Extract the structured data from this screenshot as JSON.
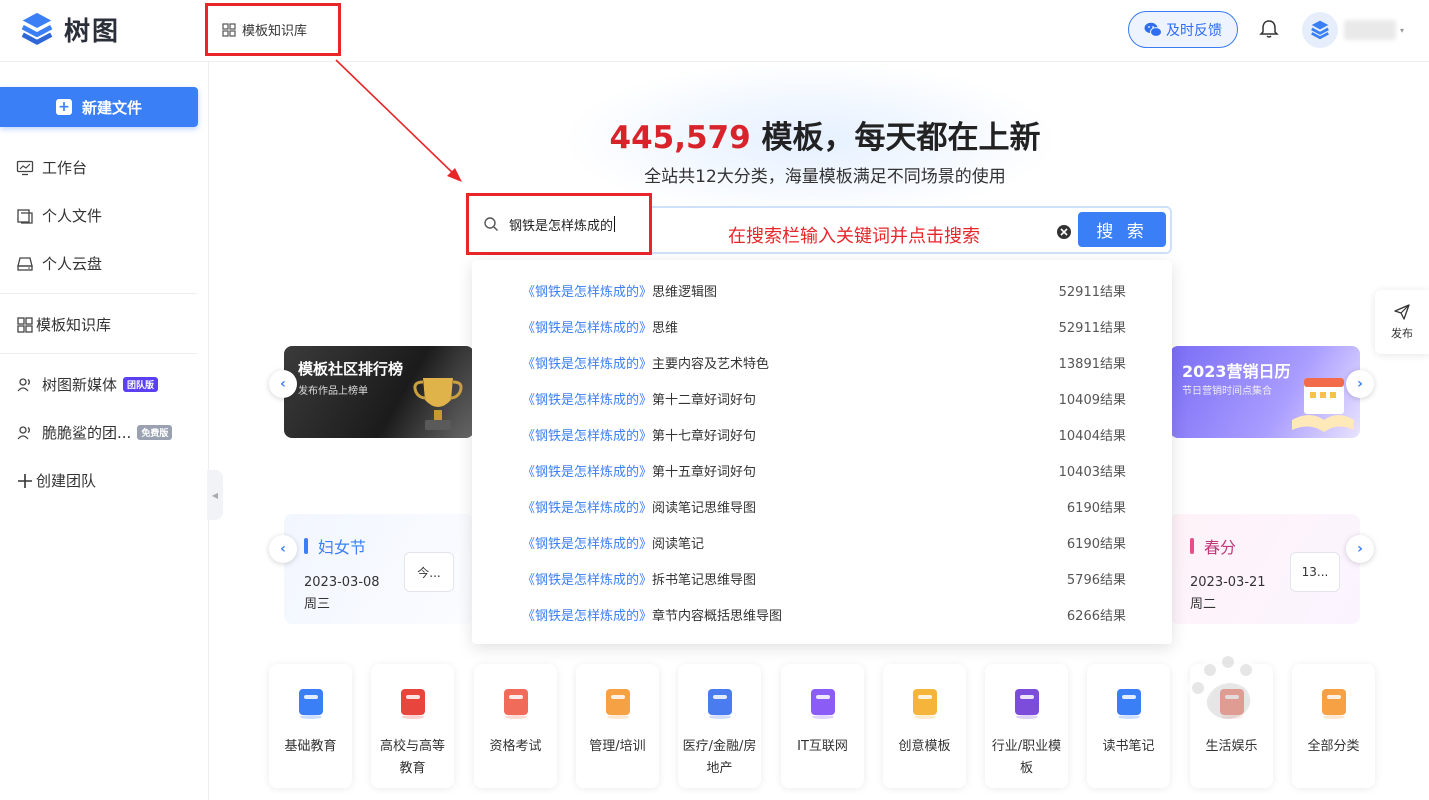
{
  "header": {
    "logo_text": "树图",
    "nav_template_label": "模板知识库",
    "feedback_label": "及时反馈"
  },
  "sidebar": {
    "new_file_label": "新建文件",
    "items": [
      {
        "label": "工作台"
      },
      {
        "label": "个人文件"
      },
      {
        "label": "个人云盘"
      },
      {
        "label": "模板知识库"
      },
      {
        "label": "树图新媒体",
        "badge": "团队版"
      },
      {
        "label": "脆脆鲨的团...",
        "badge": "免费版"
      },
      {
        "label": "创建团队"
      }
    ]
  },
  "hero": {
    "count": "445,579",
    "title_rest": " 模板，每天都在上新",
    "subtitle": "全站共12大分类，海量模板满足不同场景的使用"
  },
  "search": {
    "value": "钢铁是怎样炼成的",
    "button_label": "搜 索",
    "annotation": "在搜索栏输入关键词并点击搜索"
  },
  "suggestions": [
    {
      "keyword": "《钢铁是怎样炼成的》",
      "suffix": "思维逻辑图",
      "count": "52911结果"
    },
    {
      "keyword": "《钢铁是怎样炼成的》",
      "suffix": "思维",
      "count": "52911结果"
    },
    {
      "keyword": "《钢铁是怎样炼成的》",
      "suffix": "主要内容及艺术特色",
      "count": "13891结果"
    },
    {
      "keyword": "《钢铁是怎样炼成的》",
      "suffix": "第十二章好词好句",
      "count": "10409结果"
    },
    {
      "keyword": "《钢铁是怎样炼成的》",
      "suffix": "第十七章好词好句",
      "count": "10404结果"
    },
    {
      "keyword": "《钢铁是怎样炼成的》",
      "suffix": "第十五章好词好句",
      "count": "10403结果"
    },
    {
      "keyword": "《钢铁是怎样炼成的》",
      "suffix": "阅读笔记思维导图",
      "count": "6190结果"
    },
    {
      "keyword": "《钢铁是怎样炼成的》",
      "suffix": "阅读笔记",
      "count": "6190结果"
    },
    {
      "keyword": "《钢铁是怎样炼成的》",
      "suffix": "拆书笔记思维导图",
      "count": "5796结果"
    },
    {
      "keyword": "《钢铁是怎样炼成的》",
      "suffix": "章节内容概括思维导图",
      "count": "6266结果"
    }
  ],
  "banners": {
    "left": {
      "title": "模板社区排行榜",
      "subtitle": "发布作品上榜单"
    },
    "right": {
      "title": "2023营销日历",
      "subtitle": "节日营销时间点集合"
    }
  },
  "festivals": {
    "left": {
      "name": "妇女节",
      "date": "2023-03-08 周三",
      "chip": "今..."
    },
    "right": {
      "name": "春分",
      "date": "2023-03-21 周二",
      "chip": "13..."
    }
  },
  "publish_label": "发布",
  "categories": [
    {
      "label": "基础教育",
      "color": "#3b7ff6"
    },
    {
      "label": "高校与高等教育",
      "color": "#e8453c"
    },
    {
      "label": "资格考试",
      "color": "#f06b5a"
    },
    {
      "label": "管理/培训",
      "color": "#f5a144"
    },
    {
      "label": "医疗/金融/房地产",
      "color": "#4a7cf0"
    },
    {
      "label": "IT互联网",
      "color": "#8b5cf6"
    },
    {
      "label": "创意模板",
      "color": "#f5b53a"
    },
    {
      "label": "行业/职业模板",
      "color": "#7c4ddb"
    },
    {
      "label": "读书笔记",
      "color": "#3b7ff6"
    },
    {
      "label": "生活娱乐",
      "color": "#f06b5a"
    },
    {
      "label": "全部分类",
      "color": "#f5a144"
    }
  ],
  "colors": {
    "accent": "#3b7ff6",
    "highlight_red": "#e8262a",
    "count_red": "#d8232a"
  }
}
